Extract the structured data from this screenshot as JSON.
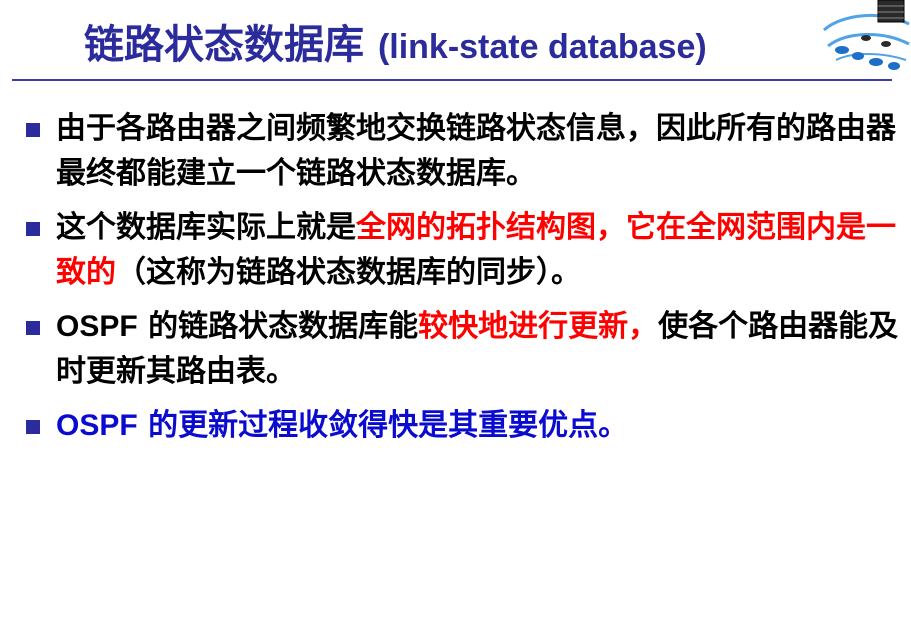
{
  "title": {
    "cjk": "链路状态数据库",
    "latin": "(link-state database)"
  },
  "bullets": [
    {
      "segments": [
        {
          "text": "由于各路由器之间频繁地交换链路状态信息，因此所有的路由器最终都能建立一个链路状态数据库。",
          "style": "normal"
        }
      ]
    },
    {
      "segments": [
        {
          "text": "这个数据库实际上就是",
          "style": "normal"
        },
        {
          "text": "全网的拓扑结构图，它在全网范围内是一致的",
          "style": "red"
        },
        {
          "text": "（这称为链路状态数据库的同步）。",
          "style": "normal"
        }
      ]
    },
    {
      "segments": [
        {
          "text": "OSPF",
          "style": "normal-latin"
        },
        {
          "text": " 的链路状态数据库能",
          "style": "normal"
        },
        {
          "text": "较快地进行更新，",
          "style": "red"
        },
        {
          "text": "使各个路由器能及时更新其路由表。",
          "style": "normal"
        }
      ]
    },
    {
      "segments": [
        {
          "text": "OSPF",
          "style": "blue-latin"
        },
        {
          "text": " 的更新过程收敛得快是其重要优点。",
          "style": "blue"
        }
      ]
    }
  ],
  "colors": {
    "title": "#2B2B9B",
    "rule": "#3C3CA8",
    "bullet_square": "#2B2B9B",
    "highlight_red": "#FF0000",
    "highlight_blue": "#0B0BD0"
  },
  "icons": [
    "network-logo-icon",
    "bullet-square-icon"
  ]
}
